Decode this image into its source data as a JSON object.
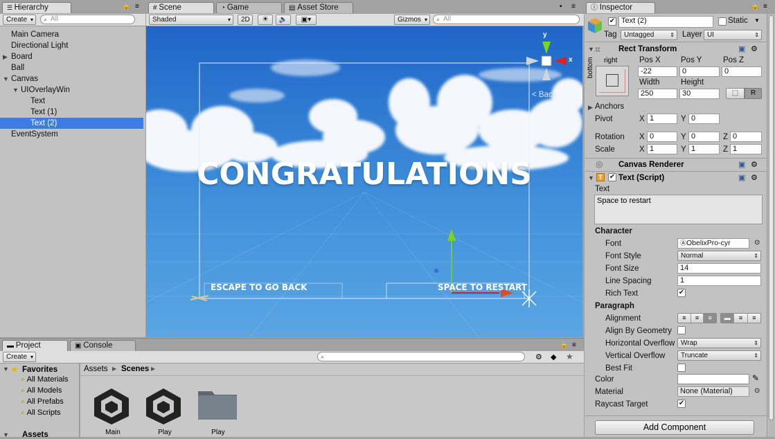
{
  "hierarchy": {
    "tab": "Hierarchy",
    "create": "Create",
    "search_placeholder": "All",
    "items": [
      {
        "label": "Main Camera"
      },
      {
        "label": "Directional Light"
      },
      {
        "label": "Board"
      },
      {
        "label": "Ball"
      },
      {
        "label": "Canvas"
      },
      {
        "label": "UIOverlayWin"
      },
      {
        "label": "Text"
      },
      {
        "label": "Text (1)"
      },
      {
        "label": "Text (2)"
      },
      {
        "label": "EventSystem"
      }
    ]
  },
  "scene": {
    "tabs": [
      {
        "label": "Scene"
      },
      {
        "label": "Game"
      },
      {
        "label": "Asset Store"
      }
    ],
    "shading": "Shaded",
    "mode_2d": "2D",
    "gizmos": "Gizmos",
    "search_placeholder": "All",
    "title": "CONGRATULATIONS",
    "escape_text": "ESCAPE TO GO BACK",
    "space_text": "SPACE TO RESTART",
    "back_label": "< Back",
    "axis_y": "y",
    "axis_x": "x"
  },
  "project": {
    "tabs": [
      {
        "label": "Project"
      },
      {
        "label": "Console"
      }
    ],
    "create": "Create",
    "favorites_label": "Favorites",
    "favorites": [
      {
        "label": "All Materials"
      },
      {
        "label": "All Models"
      },
      {
        "label": "All Prefabs"
      },
      {
        "label": "All Scripts"
      }
    ],
    "assets_label": "Assets",
    "breadcrumb_assets": "Assets",
    "breadcrumb_scenes": "Scenes",
    "files": [
      {
        "label": "Main"
      },
      {
        "label": "Play"
      },
      {
        "label": "Play"
      }
    ]
  },
  "inspector": {
    "tab": "Inspector",
    "object_name": "Text (2)",
    "static_label": "Static",
    "tag_label": "Tag",
    "tag_value": "Untagged",
    "layer_label": "Layer",
    "layer_value": "UI",
    "rect_transform": {
      "title": "Rect Transform",
      "anchor_h": "right",
      "anchor_v": "bottom",
      "pos_x_label": "Pos X",
      "pos_y_label": "Pos Y",
      "pos_z_label": "Pos Z",
      "pos_x": "-22",
      "pos_y": "0",
      "pos_z": "0",
      "width_label": "Width",
      "height_label": "Height",
      "width": "250",
      "height": "30",
      "r_button": "R",
      "anchors_label": "Anchors",
      "pivot_label": "Pivot",
      "pivot_x": "1",
      "pivot_y": "0",
      "rotation_label": "Rotation",
      "rot_x": "0",
      "rot_y": "0",
      "rot_z": "0",
      "scale_label": "Scale",
      "scale_x": "1",
      "scale_y": "1",
      "scale_z": "1",
      "x": "X",
      "y": "Y",
      "z": "Z"
    },
    "canvas_renderer": {
      "title": "Canvas Renderer"
    },
    "text_script": {
      "title": "Text (Script)",
      "text_label": "Text",
      "text_value": "Space to restart",
      "character_label": "Character",
      "font_label": "Font",
      "font_value": "ObelixPro-cyr",
      "font_style_label": "Font Style",
      "font_style_value": "Normal",
      "font_size_label": "Font Size",
      "font_size_value": "14",
      "line_spacing_label": "Line Spacing",
      "line_spacing_value": "1",
      "rich_text_label": "Rich Text",
      "paragraph_label": "Paragraph",
      "alignment_label": "Alignment",
      "align_by_geometry_label": "Align By Geometry",
      "h_overflow_label": "Horizontal Overflow",
      "h_overflow_value": "Wrap",
      "v_overflow_label": "Vertical Overflow",
      "v_overflow_value": "Truncate",
      "best_fit_label": "Best Fit",
      "color_label": "Color",
      "material_label": "Material",
      "material_value": "None (Material)",
      "raycast_label": "Raycast Target"
    },
    "add_component": "Add Component"
  },
  "colors": {
    "selection": "#3e7ce4",
    "sky_top": "#1f66c8",
    "sky_bottom": "#5aa6e3",
    "panel": "#c2c2c2"
  }
}
